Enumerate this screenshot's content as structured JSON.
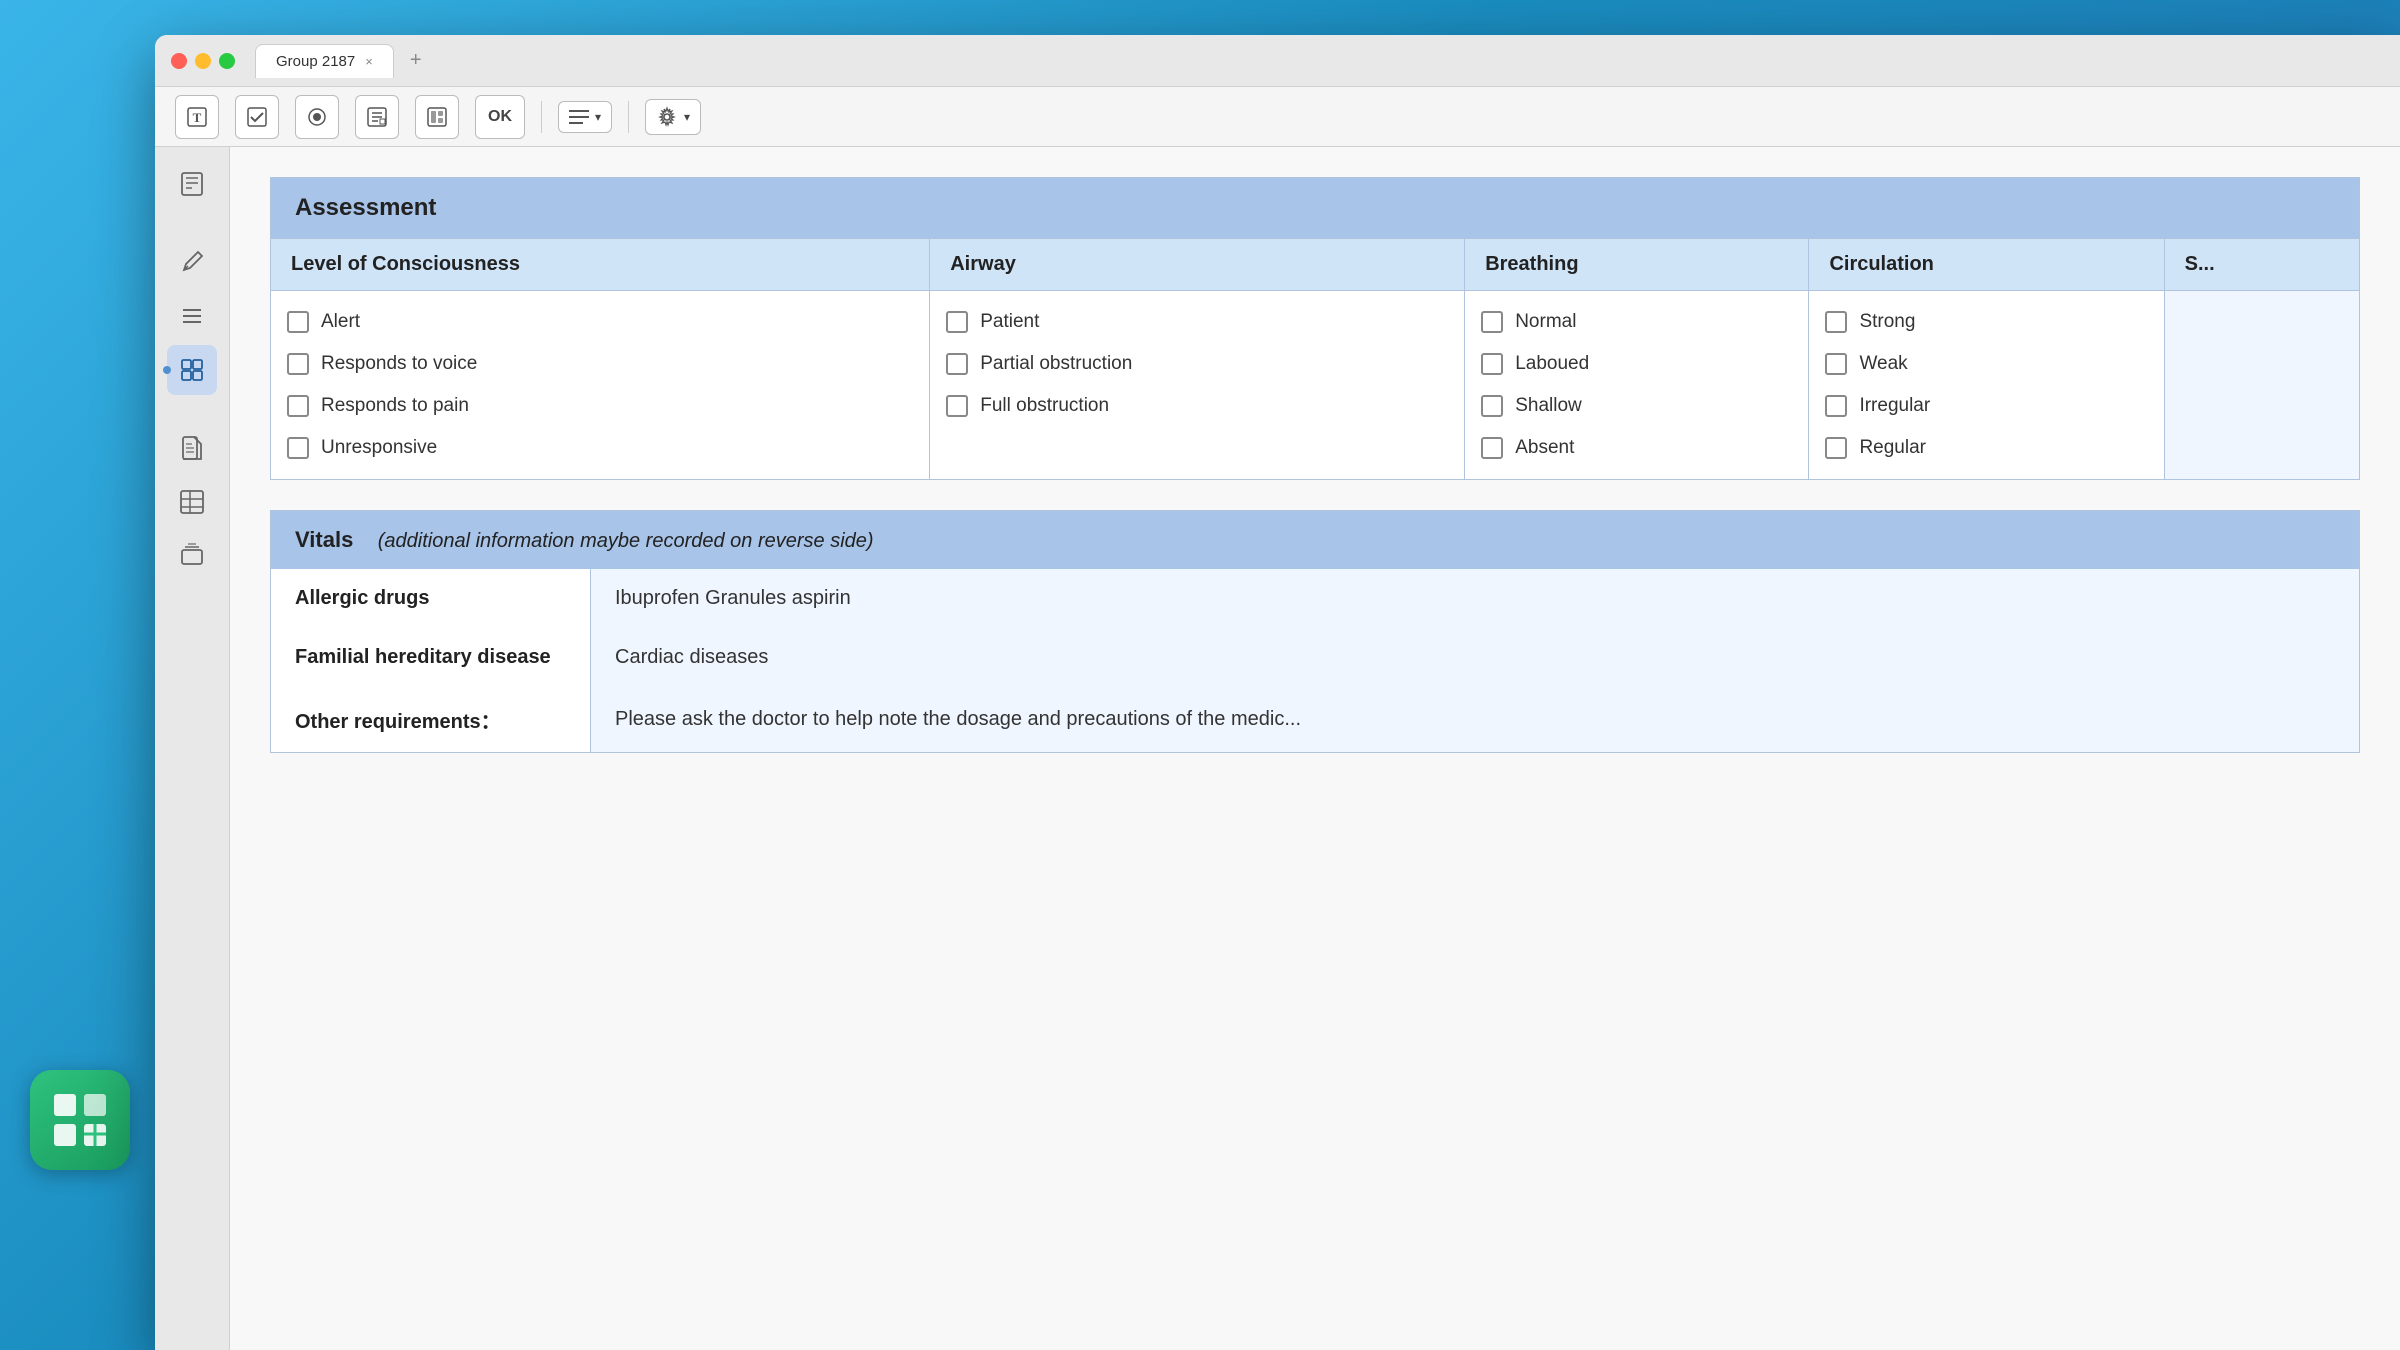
{
  "window": {
    "title": "Group 2187",
    "tab_close": "×",
    "tab_add": "+"
  },
  "toolbar": {
    "buttons": [
      {
        "name": "text-tool",
        "icon": "T",
        "label": "Text Tool"
      },
      {
        "name": "checkbox-tool",
        "icon": "✓",
        "label": "Checkbox Tool"
      },
      {
        "name": "record-tool",
        "icon": "●",
        "label": "Record Tool"
      },
      {
        "name": "form-tool",
        "icon": "≡+",
        "label": "Form Tool"
      },
      {
        "name": "layout-tool",
        "icon": "⊟",
        "label": "Layout Tool"
      },
      {
        "name": "ok-btn",
        "icon": "OK",
        "label": "OK"
      },
      {
        "name": "list-tool",
        "icon": "≡",
        "label": "List Tool"
      },
      {
        "name": "settings-tool",
        "icon": "⚙",
        "label": "Settings Tool"
      }
    ]
  },
  "sidebar": {
    "items": [
      {
        "name": "book-icon",
        "icon": "📋",
        "active": false
      },
      {
        "name": "pen-icon",
        "icon": "✏",
        "active": false
      },
      {
        "name": "list-icon",
        "icon": "≡",
        "active": false
      },
      {
        "name": "grid-icon",
        "icon": "⊞",
        "active": true
      },
      {
        "name": "doc-icon",
        "icon": "📄",
        "active": false
      },
      {
        "name": "table-icon",
        "icon": "⊟",
        "active": false
      },
      {
        "name": "stack-icon",
        "icon": "❑",
        "active": false
      }
    ]
  },
  "assessment": {
    "title": "Assessment",
    "columns": [
      {
        "header": "Level of Consciousness",
        "items": [
          "Alert",
          "Responds to voice",
          "Responds to pain",
          "Unresponsive"
        ]
      },
      {
        "header": "Airway",
        "items": [
          "Patient",
          "Partial obstruction",
          "Full obstruction"
        ]
      },
      {
        "header": "Breathing",
        "items": [
          "Normal",
          "Laboued",
          "Shallow",
          "Absent"
        ]
      },
      {
        "header": "Circulation",
        "items": [
          "Strong",
          "Weak",
          "Irregular",
          "Regular"
        ]
      },
      {
        "header": "S...",
        "items": []
      }
    ]
  },
  "vitals": {
    "title": "Vitals",
    "subtitle": "(additional information maybe recorded on reverse side)",
    "rows": [
      {
        "label": "Allergic drugs",
        "value": "Ibuprofen Granules  aspirin"
      },
      {
        "label": "Familial hereditary disease",
        "value": "Cardiac diseases"
      },
      {
        "label": "Other requirements：",
        "value": "Please ask the doctor to help note the dosage and precautions of the medic..."
      }
    ]
  },
  "app_icon": "⊞"
}
